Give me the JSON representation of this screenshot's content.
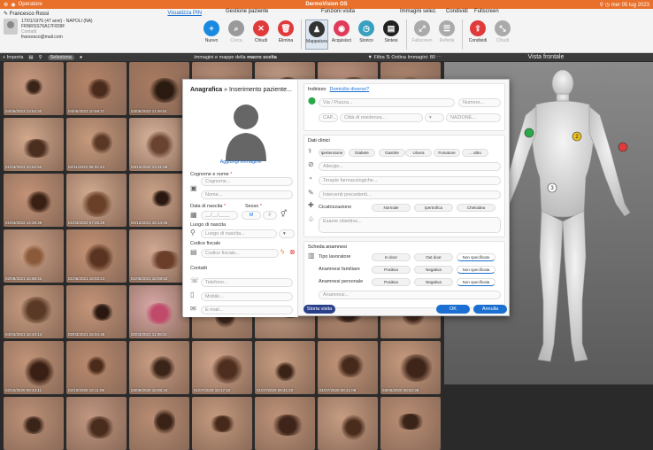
{
  "titlebar": {
    "operator": "Operatore",
    "app_title": "DermoVision OS",
    "datetime": "mer 05 lug 2023"
  },
  "patient": {
    "name": "Francesco Rossi",
    "visualizza_link": "Visualizza PIN",
    "birth": "17/01/1976 (47 anni) - NAPOLI (NA)",
    "code": "FRNRSS76A17F839F",
    "contacts_label": "Contatti",
    "email": "francesco@mail.com"
  },
  "groups": {
    "gestione": "Gestione paziente",
    "funzioni": "Funzioni visita",
    "immagini": "Immagini selez.",
    "condividi": "Condividi",
    "fullscreen": "Fullscreen"
  },
  "tools": [
    {
      "label": "Nuovo",
      "color": "#1a8ae0",
      "glyph": "+",
      "icon": "plus-icon"
    },
    {
      "label": "Cerca",
      "color": "#9a9a9a",
      "glyph": "⌕",
      "icon": "search-icon",
      "disabled": true
    },
    {
      "label": "Chiudi",
      "color": "#e03a3a",
      "glyph": "✕",
      "icon": "close-icon"
    },
    {
      "label": "Elimina",
      "color": "#e03a3a",
      "glyph": "🗑",
      "icon": "trash-icon"
    },
    {
      "label": "Mappatura",
      "color": "#333333",
      "glyph": "♟",
      "icon": "body-map-icon",
      "active": true
    },
    {
      "label": "Acquisisci",
      "color": "#e03a5a",
      "glyph": "◉",
      "icon": "camera-icon"
    },
    {
      "label": "Storico",
      "color": "#3aa0c0",
      "glyph": "◷",
      "icon": "history-icon"
    },
    {
      "label": "Sintesi",
      "color": "#222222",
      "glyph": "▤",
      "icon": "summary-icon"
    },
    {
      "label": "Fullscreen",
      "color": "#aaaaaa",
      "glyph": "⤢",
      "icon": "fullscreen-icon",
      "disabled": true
    },
    {
      "label": "Refertà",
      "color": "#aaaaaa",
      "glyph": "☰",
      "icon": "report-icon",
      "disabled": true
    },
    {
      "label": "Condividi",
      "color": "#e03a3a",
      "glyph": "⇪",
      "icon": "share-icon"
    },
    {
      "label": "Chiudi",
      "color": "#aaaaaa",
      "glyph": "⤡",
      "icon": "exit-fullscreen-icon",
      "disabled": true
    }
  ],
  "subbar": {
    "importa": "Importa",
    "seleziona": "Seleziona",
    "center": "Immagini e mappe della",
    "center_bold": "macro scelta",
    "filtra": "Filtra",
    "ordina": "Ordina",
    "count": "Immagini: 80",
    "vista": "Vista frontale"
  },
  "thumbs": [
    {
      "cap": "04/05/2023 13:54:30",
      "bg": "#c89a80",
      "spot": "#3a2418"
    },
    {
      "cap": "04/05/2023 10:59:27",
      "bg": "#b58468",
      "spot": "#4a2a1a"
    },
    {
      "cap": "03/05/2023 11:08:51",
      "bg": "#a87a60",
      "spot": "#2a1a10"
    },
    {
      "cap": "",
      "bg": "#b9907a",
      "spot": "#553322"
    },
    {
      "cap": "",
      "bg": "#c4a08a",
      "spot": "#3a2218"
    },
    {
      "cap": "",
      "bg": "#c09482",
      "spot": "#4a2c1c"
    },
    {
      "cap": "",
      "bg": "#ad8670",
      "spot": "#3b2216"
    },
    {
      "cap": "01/03/2023 10:52:50",
      "bg": "#d1a88c",
      "spot": "#4a2e1e"
    },
    {
      "cap": "02/11/2022 08:32:43",
      "bg": "#c69a7c",
      "spot": "#5a3826"
    },
    {
      "cap": "03/10/2022 12:31:08",
      "bg": "#d8b49c",
      "spot": "#6a4230"
    },
    {
      "cap": "",
      "bg": "#bf977c",
      "spot": "#3a2418"
    },
    {
      "cap": "",
      "bg": "#c7a086",
      "spot": "#4e2e20"
    },
    {
      "cap": "",
      "bg": "#b68a70",
      "spot": "#3f251a"
    },
    {
      "cap": "",
      "bg": "#c99e84",
      "spot": "#45291b"
    },
    {
      "cap": "01/03/2022 14:28:39",
      "bg": "#c29276",
      "spot": "#3a2014"
    },
    {
      "cap": "01/03/2022 07:45:29",
      "bg": "#d2aa90",
      "spot": "#6a4028"
    },
    {
      "cap": "02/12/2021 16:14:48",
      "bg": "#caa288",
      "spot": "#2a1810"
    },
    {
      "cap": "",
      "bg": "#c0957a",
      "spot": "#4a2c1c"
    },
    {
      "cap": "",
      "bg": "#b98e74",
      "spot": "#3a2418"
    },
    {
      "cap": "",
      "bg": "#c59c80",
      "spot": "#55311f"
    },
    {
      "cap": "",
      "bg": "#bd9078",
      "spot": "#3f2519"
    },
    {
      "cap": "02/08/2021 16:58:42",
      "bg": "#cba086",
      "spot": "#8a5a3a"
    },
    {
      "cap": "01/08/2021 18:03:21",
      "bg": "#c59274",
      "spot": "#5a3420"
    },
    {
      "cap": "01/08/2021 18:08:52",
      "bg": "#d0a892",
      "spot": "#6a3e28"
    },
    {
      "cap": "",
      "bg": "#be9479",
      "spot": "#3a2418"
    },
    {
      "cap": "",
      "bg": "#c8a088",
      "spot": "#4a2c1c"
    },
    {
      "cap": "",
      "bg": "#b48a70",
      "spot": "#3b2216"
    },
    {
      "cap": "",
      "bg": "#c59a80",
      "spot": "#47291b"
    },
    {
      "cap": "04/03/2021 16:40:14",
      "bg": "#c89c80",
      "spot": "#5a3a26"
    },
    {
      "cap": "02/03/2021 15:04:46",
      "bg": "#c49478",
      "spot": "#2a1810"
    },
    {
      "cap": "02/03/2021 11:08:21",
      "bg": "#d8a8a8",
      "spot": "#c04a6a"
    },
    {
      "cap": "",
      "bg": "#bc9378",
      "spot": "#3a2418"
    },
    {
      "cap": "",
      "bg": "#c6a086",
      "spot": "#4a2c1c"
    },
    {
      "cap": "",
      "bg": "#b78c72",
      "spot": "#3b2216"
    },
    {
      "cap": "",
      "bg": "#c49a7e",
      "spot": "#47291b"
    },
    {
      "cap": "02/10/2020 08:43:11",
      "bg": "#c29478",
      "spot": "#3a2014"
    },
    {
      "cap": "02/10/2020 18:11:08",
      "bg": "#ba8a6e",
      "spot": "#4a2a18"
    },
    {
      "cap": "03/08/2020 16:06:34",
      "bg": "#c89c82",
      "spot": "#3a2418"
    },
    {
      "cap": "01/07/2020 18:17:10",
      "bg": "#d0a48a",
      "spot": "#4e2e1e"
    },
    {
      "cap": "01/07/2020 08:41:20",
      "bg": "#c69c80",
      "spot": "#3a2216"
    },
    {
      "cap": "01/07/2020 08:41:08",
      "bg": "#c19478",
      "spot": "#45291b"
    },
    {
      "cap": "03/06/2020 08:52:38",
      "bg": "#c69a7e",
      "spot": "#3f2519"
    },
    {
      "cap": "",
      "bg": "#bc9076",
      "spot": "#3a2418"
    },
    {
      "cap": "",
      "bg": "#c09680",
      "spot": "#4a2c1c"
    },
    {
      "cap": "",
      "bg": "#b88c72",
      "spot": "#3b2216"
    },
    {
      "cap": "",
      "bg": "#c49a7e",
      "spot": "#47291b"
    },
    {
      "cap": "",
      "bg": "#be9278",
      "spot": "#3f2519"
    },
    {
      "cap": "",
      "bg": "#c69c82",
      "spot": "#4a2c1c"
    },
    {
      "cap": "",
      "bg": "#ba8e74",
      "spot": "#3a2418"
    }
  ],
  "modal": {
    "title_bold": "Anagrafica",
    "title_rest": "» Inserimento paziente...",
    "aggiungi": "Aggiungi immagine",
    "cognome_label": "Cognome e nome",
    "cognome_ph": "Cognome...",
    "nome_ph": "Nome...",
    "nascita_label": "Data di nascita",
    "data_ph": "__/__/____",
    "sesso_label": "Sesso",
    "sesso_m": "M",
    "sesso_f": "F",
    "luogo_label": "Luogo di nascita",
    "luogo_ph": "Luogo di nascita...",
    "cf_label": "Codice fiscale",
    "cf_ph": "Codice fiscale...",
    "contatti_label": "Contatti",
    "tel_ph": "Telefono...",
    "mob_ph": "Mobile...",
    "email_ph": "E-mail...",
    "indirizzo_label": "Indirizzo",
    "domicilio_link": "Domicilio diverso?",
    "via_ph": "Via / Piazza...",
    "numero_ph": "Numero...",
    "cap_ph": "CAP...",
    "citta_ph": "Città di residenza...",
    "nazione_ph": "NAZIONE...",
    "clinici_label": "Dati clinici",
    "chips1": [
      "Ipertensione",
      "Diabete",
      "Gastrite",
      "Ulcera",
      "Fumatore",
      "... altro"
    ],
    "allergie_ph": "Allergie...",
    "terapie_ph": "Terapie farmacologiche...",
    "interventi_ph": "Interventi precedenti...",
    "cicatrizzazione_label": "Cicatrizzazione",
    "cic_opts": [
      "Normale",
      "Ipertrofica",
      "Cheloidea"
    ],
    "esame_ph": "Esame obiettivo...",
    "anamnesi_label": "Scheda anamnesi",
    "row1_label": "Tipo lavoratore",
    "row1_opts": [
      "In door",
      "Out door",
      "Non specificato"
    ],
    "row2_label": "Anamnesi familiare",
    "row2_opts": [
      "Positiva",
      "Negativa",
      "Non specificata"
    ],
    "row3_label": "Anamnesi personale",
    "row3_opts": [
      "Positiva",
      "Negativa",
      "Non specificata"
    ],
    "anamnesi_ph": "Anamnesi...",
    "storia_btn": "Storia visita",
    "ok_btn": "OK",
    "annulla_btn": "Annulla"
  },
  "markers": [
    {
      "label": "",
      "color": "#2aa84a"
    },
    {
      "label": "2",
      "color": "#e8c020"
    },
    {
      "label": "",
      "color": "#e03a3a"
    },
    {
      "label": "3",
      "color": "#ffffff"
    }
  ]
}
